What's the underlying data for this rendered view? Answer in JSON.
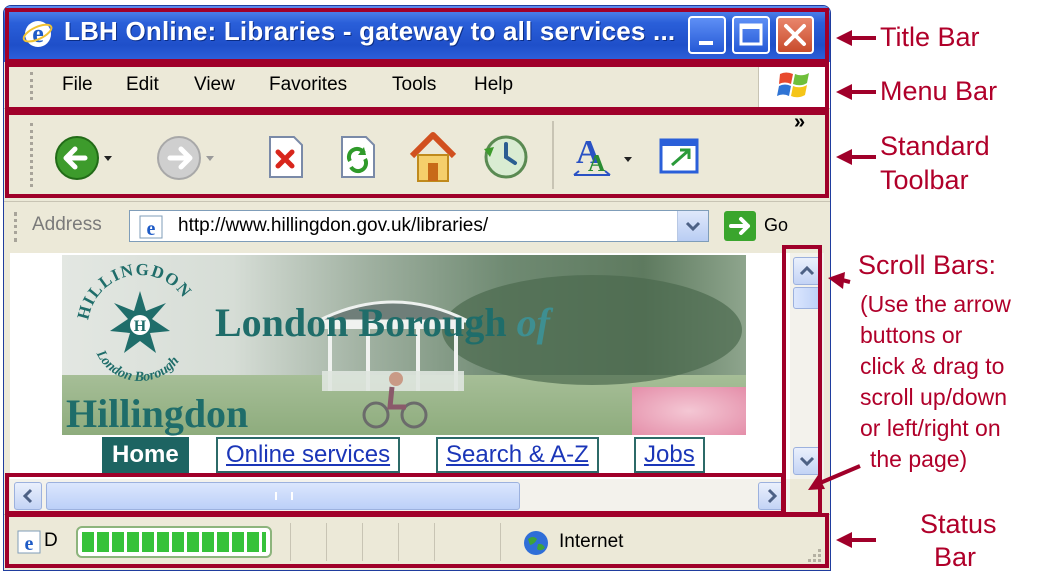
{
  "window": {
    "title": "LBH Online: Libraries - gateway to all services ..."
  },
  "menu": [
    "File",
    "Edit",
    "View",
    "Favorites",
    "Tools",
    "Help"
  ],
  "toolbar": {
    "buttons": [
      "back-icon",
      "forward-icon",
      "stop-icon",
      "refresh-icon",
      "home-icon",
      "history-icon",
      "text-size-icon",
      "new-window-icon"
    ],
    "chevron": "»"
  },
  "address_bar": {
    "label": "Address",
    "url": "http://www.hillingdon.gov.uk/libraries/",
    "go_label": "Go"
  },
  "page": {
    "logo_top": "HILLINGDON",
    "logo_bottom": "London Borough",
    "logo_letter": "H",
    "heading_main": "London Borough",
    "heading_of": "of",
    "heading_sub": "Hillingdon",
    "nav": [
      "Home",
      "Online services",
      "Search & A-Z",
      "Jobs"
    ]
  },
  "status_bar": {
    "text": "D",
    "zone": "Internet",
    "progress": 1.0
  },
  "annotations": {
    "title_bar": "Title Bar",
    "menu_bar": "Menu Bar",
    "standard_toolbar": [
      "Standard",
      "Toolbar"
    ],
    "scroll_bars": "Scroll Bars:",
    "scroll_note": [
      "(Use the arrow",
      "buttons or",
      "click & drag to",
      "scroll up/down",
      "or left/right on",
      "the page)"
    ],
    "status_bar": [
      "Status",
      "Bar"
    ]
  },
  "colors": {
    "highlight": "#a0002a",
    "titlebar": "#2a5fd9",
    "chrome": "#ece9d8",
    "page_green": "#1f6d6a"
  }
}
